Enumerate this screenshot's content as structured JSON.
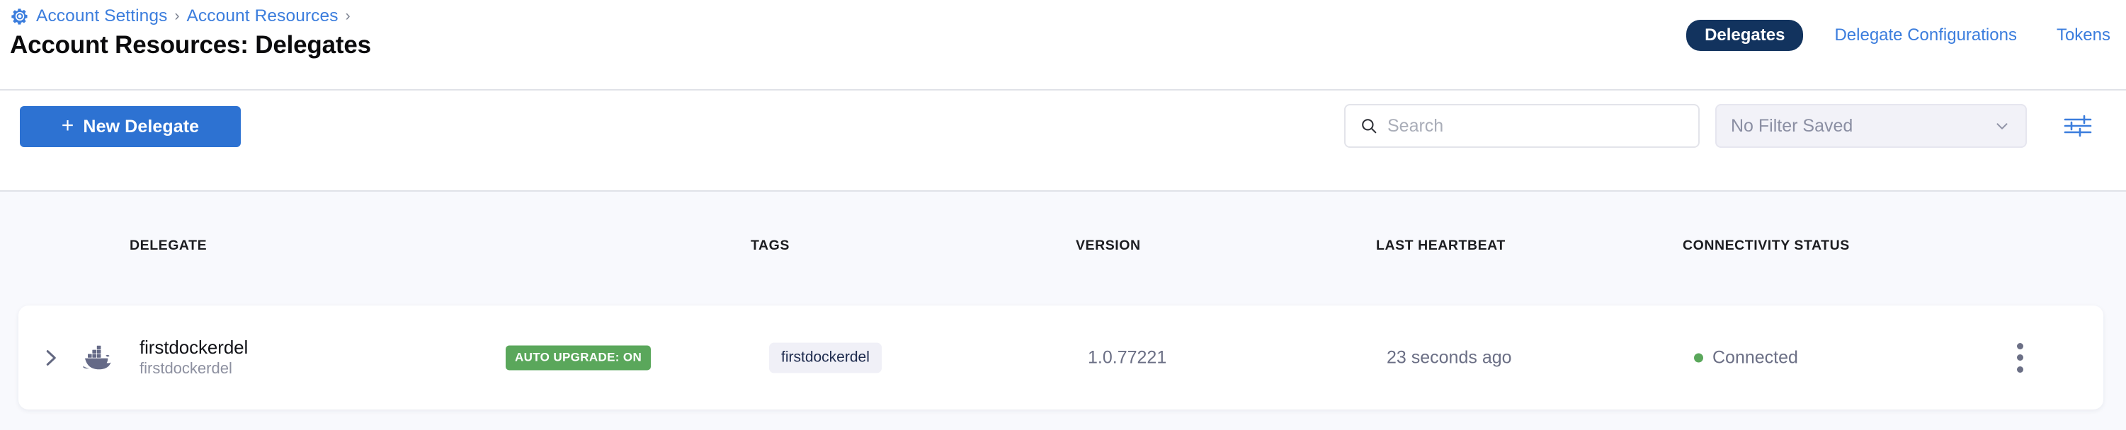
{
  "breadcrumb": {
    "gear_icon": "gear-icon",
    "items": [
      "Account Settings",
      "Account Resources"
    ],
    "separator": "›"
  },
  "header": {
    "title": "Account Resources: Delegates",
    "tabs": [
      {
        "label": "Delegates",
        "active": true
      },
      {
        "label": "Delegate Configurations",
        "active": false
      },
      {
        "label": "Tokens",
        "active": false
      }
    ]
  },
  "toolbar": {
    "new_delegate_label": "New Delegate",
    "new_delegate_plus": "+",
    "search": {
      "icon": "search-icon",
      "placeholder": "Search",
      "value": ""
    },
    "filter": {
      "selected": "No Filter Saved",
      "chevron_icon": "chevron-down-icon"
    },
    "filter_settings_icon": "filter-settings-icon"
  },
  "table": {
    "columns": [
      "DELEGATE",
      "TAGS",
      "VERSION",
      "LAST HEARTBEAT",
      "CONNECTIVITY STATUS"
    ],
    "rows": [
      {
        "expand_icon": "chevron-right-icon",
        "type_icon": "docker-icon",
        "name": "firstdockerdel",
        "sub_name": "firstdockerdel",
        "badge": "AUTO UPGRADE: ON",
        "tags": [
          "firstdockerdel"
        ],
        "version": "1.0.77221",
        "last_heartbeat": "23 seconds ago",
        "connectivity_status": "Connected",
        "menu_icon": "kebab-menu-icon"
      }
    ]
  },
  "colors": {
    "accent_blue": "#2d72d2",
    "link_blue": "#3b7ddd",
    "active_tab_navy": "#12335e",
    "status_green": "#5aa75b",
    "table_bg": "#f8f9fd",
    "chip_bg": "#f0f0f7"
  }
}
